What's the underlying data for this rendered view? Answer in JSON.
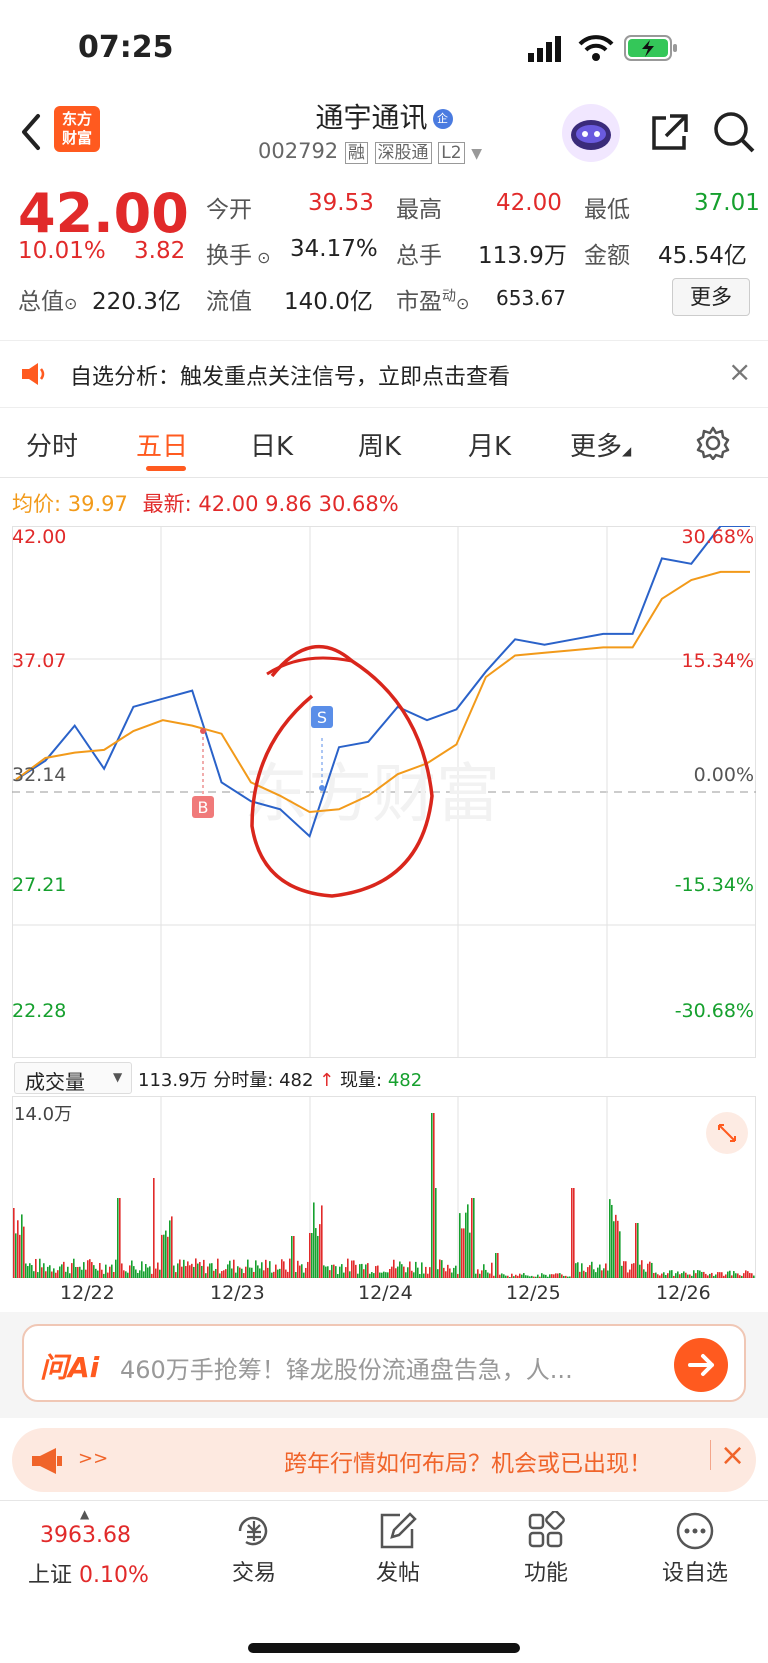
{
  "status": {
    "time": "07:25"
  },
  "stock": {
    "name": "通宇通讯",
    "code": "002792",
    "tags": [
      "融",
      "深股通",
      "L2"
    ],
    "badge": "企"
  },
  "logo": {
    "line1": "东方",
    "line2": "财富"
  },
  "quote": {
    "price": "42.00",
    "pct": "10.01%",
    "change": "3.82",
    "open_label": "今开",
    "open": "39.53",
    "high_label": "最高",
    "high": "42.00",
    "low_label": "最低",
    "low": "37.01",
    "turnover_label": "换手",
    "turnover": "34.17%",
    "volume_label": "总手",
    "volume": "113.9万",
    "amount_label": "金额",
    "amount": "45.54亿",
    "mktcap_label": "总值",
    "mktcap": "220.3亿",
    "float_label": "流值",
    "float": "140.0亿",
    "pe_label": "市盈",
    "pe_sup": "动",
    "pe": "653.67",
    "more": "更多"
  },
  "banner1": {
    "text": "自选分析：触发重点关注信号，立即点击查看"
  },
  "tabs": [
    "分时",
    "五日",
    "日K",
    "周K",
    "月K",
    "更多"
  ],
  "active_tab": "五日",
  "chart_header": {
    "avg_label": "均价:",
    "avg": "39.97",
    "latest_label": "最新:",
    "latest": "42.00",
    "chg": "9.86",
    "pct": "30.68%"
  },
  "chart_data": {
    "type": "line",
    "left_ticks": [
      "42.00",
      "37.07",
      "32.14",
      "27.21",
      "22.28"
    ],
    "right_ticks": [
      "30.68%",
      "15.34%",
      "0.00%",
      "-15.34%",
      "-30.68%"
    ],
    "x_labels": [
      "12/22",
      "12/23",
      "12/24",
      "12/25",
      "12/26"
    ],
    "ylim": [
      22.28,
      42.0
    ],
    "prev_close": 32.14,
    "series": [
      {
        "color": "#2a62c9",
        "values": [
          32.6,
          33.3,
          34.6,
          33.0,
          35.3,
          35.6,
          35.9,
          32.5,
          31.8,
          31.5,
          30.5,
          33.8,
          34.0,
          35.3,
          34.8,
          35.2,
          36.6,
          37.8,
          37.6,
          37.8,
          38.0,
          38.0,
          40.8,
          40.6,
          42.0,
          42.0
        ]
      },
      {
        "color": "#f29a1a",
        "values": [
          32.6,
          33.4,
          33.6,
          33.7,
          34.4,
          34.8,
          34.6,
          34.3,
          32.5,
          32.0,
          31.4,
          31.5,
          32.0,
          32.8,
          33.2,
          33.9,
          36.4,
          37.2,
          37.3,
          37.4,
          37.5,
          37.5,
          39.3,
          40.0,
          40.3,
          40.3
        ]
      }
    ],
    "markers": [
      {
        "text": "B"
      },
      {
        "text": "S"
      }
    ]
  },
  "volume": {
    "label": "成交量",
    "total": "113.9万",
    "period_label": "分时量:",
    "period": "482",
    "now_label": "现量:",
    "now": "482",
    "scale": "14.0万",
    "watermark": "东方财富"
  },
  "ai": {
    "brand": "问Ai",
    "text": "460万手抢筹！锋龙股份流通盘告急，人..."
  },
  "banner2": {
    "arrows": ">>",
    "text": "跨年行情如何布局？机会或已出现！"
  },
  "bottom": {
    "index_value": "3963.68",
    "index_name": "上证",
    "index_pct": "0.10%",
    "items": [
      "交易",
      "发帖",
      "功能",
      "设自选"
    ]
  },
  "colors": {
    "red": "#e12a2a",
    "green": "#16a02e",
    "blue": "#2a62c9",
    "orange": "#f29a1a",
    "brand": "#ff5a1f"
  }
}
